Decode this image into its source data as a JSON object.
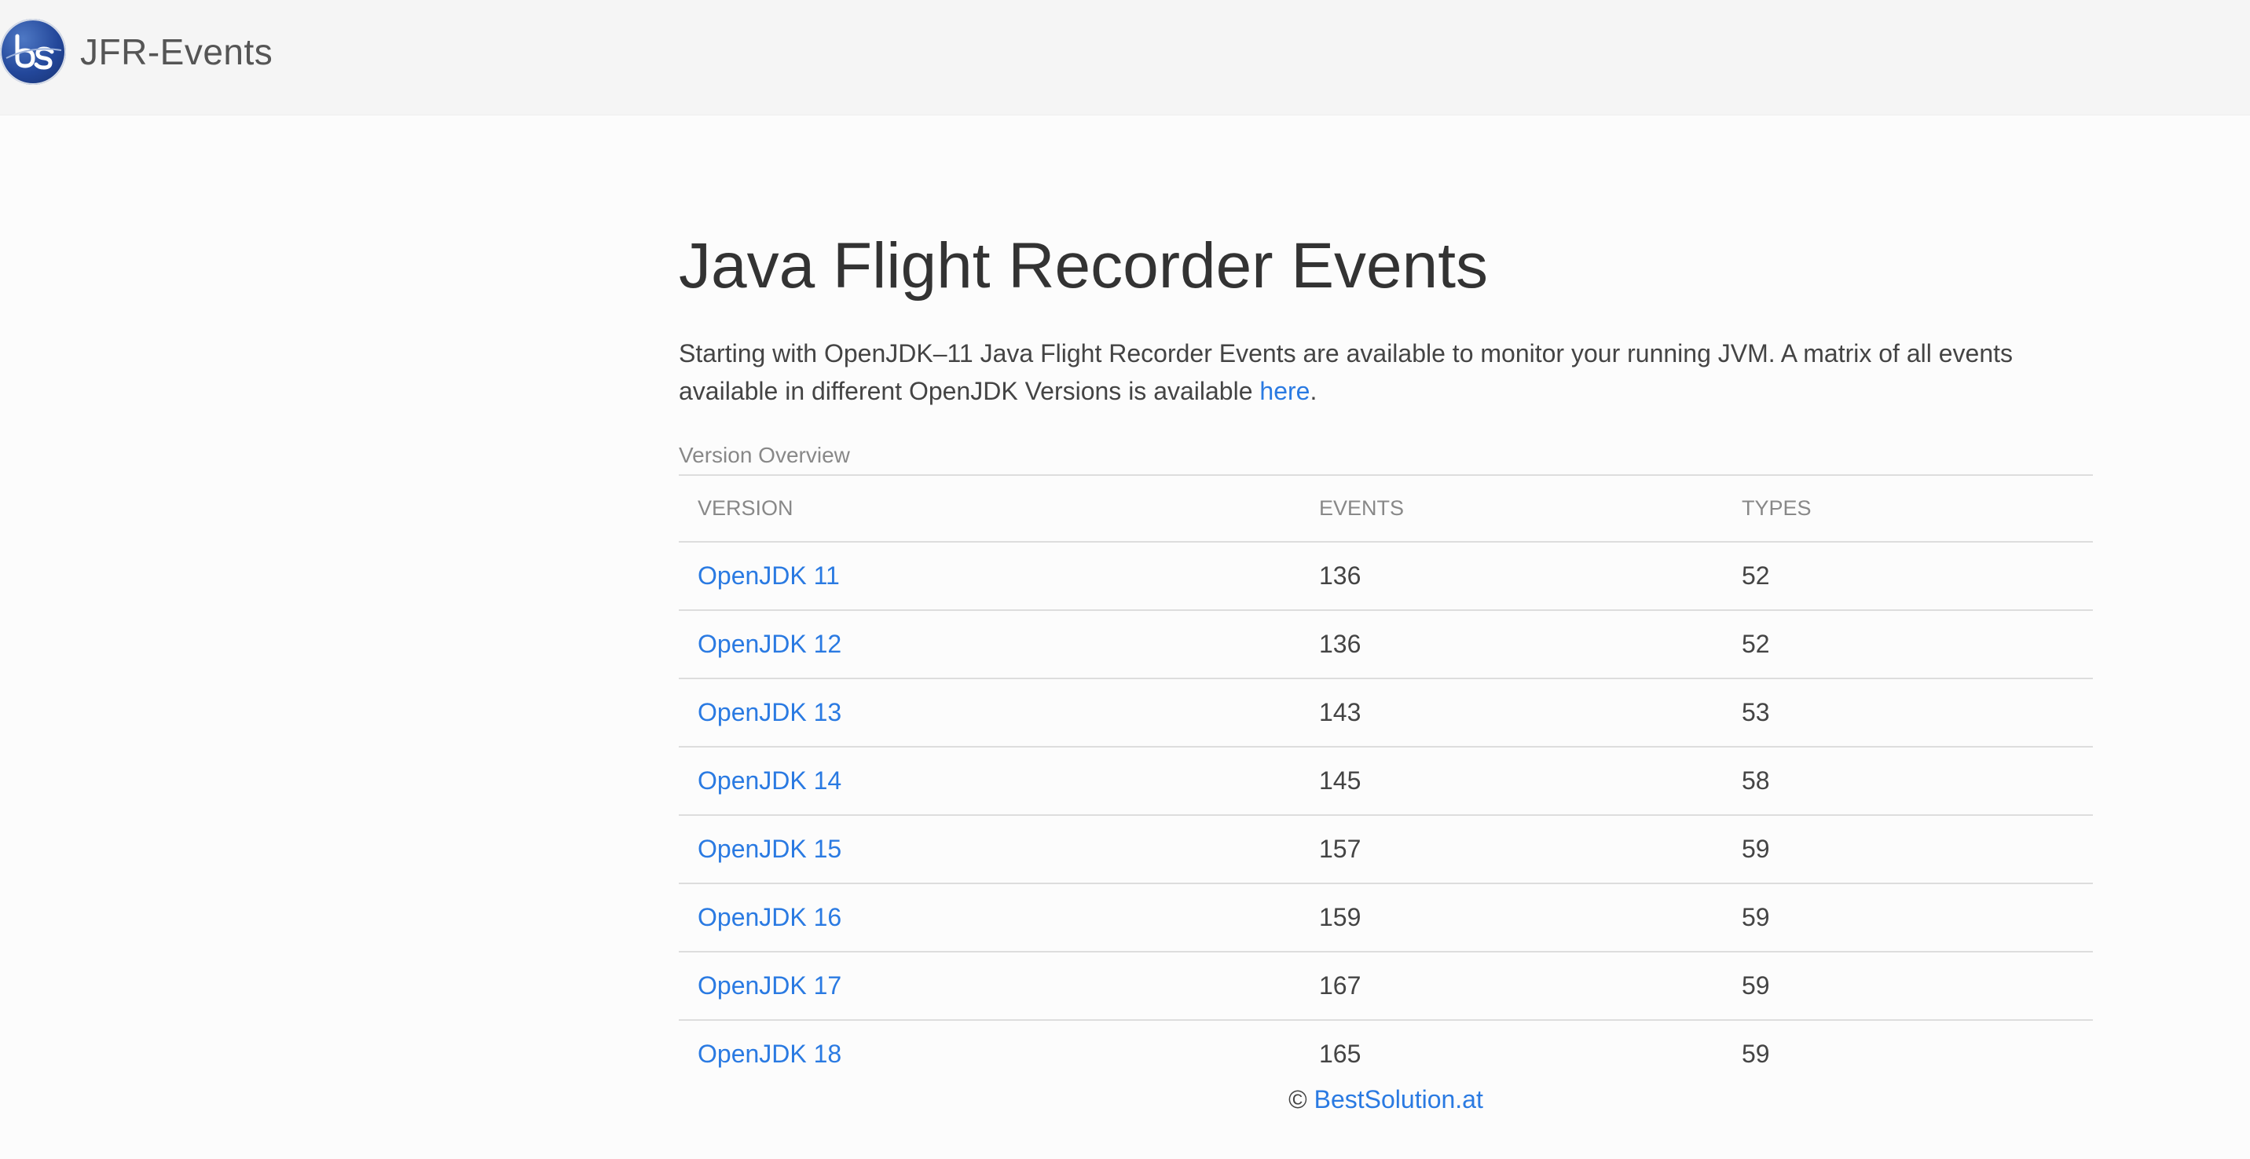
{
  "navbar": {
    "brand_name": "JFR-Events",
    "logo_icon": "bestsolution-logo-icon"
  },
  "main": {
    "title": "Java Flight Recorder Events",
    "intro_text": "Starting with OpenJDK–11 Java Flight Recorder Events are available to monitor your running JVM. A matrix of all events available in different OpenJDK Versions is available ",
    "intro_link": "here",
    "intro_end": "."
  },
  "table": {
    "caption": "Version Overview",
    "headers": [
      "VERSION",
      "EVENTS",
      "TYPES"
    ],
    "rows": [
      {
        "version": "OpenJDK 11",
        "events": "136",
        "types": "52"
      },
      {
        "version": "OpenJDK 12",
        "events": "136",
        "types": "52"
      },
      {
        "version": "OpenJDK 13",
        "events": "143",
        "types": "53"
      },
      {
        "version": "OpenJDK 14",
        "events": "145",
        "types": "58"
      },
      {
        "version": "OpenJDK 15",
        "events": "157",
        "types": "59"
      },
      {
        "version": "OpenJDK 16",
        "events": "159",
        "types": "59"
      },
      {
        "version": "OpenJDK 17",
        "events": "167",
        "types": "59"
      },
      {
        "version": "OpenJDK 18",
        "events": "165",
        "types": "59"
      }
    ]
  },
  "footer": {
    "copyright": "© ",
    "link": "BestSolution.at"
  },
  "colors": {
    "link": "#2a7ae2",
    "logo": "#23479a",
    "navbar_bg": "#f5f5f5"
  }
}
